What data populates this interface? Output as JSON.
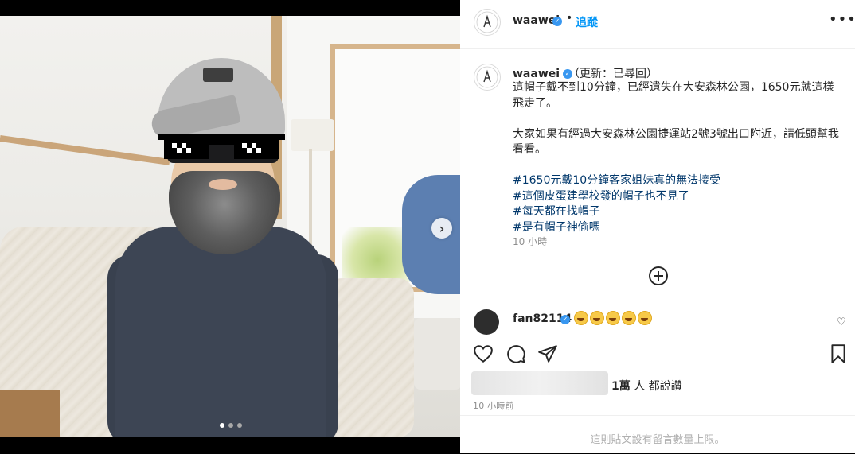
{
  "post": {
    "username": "waawei",
    "follow_label": "追蹤",
    "separator": "•",
    "more_label": "•••",
    "photo_dots": 3,
    "photo_dot_active": 1
  },
  "caption": {
    "username": "waawei",
    "note": "（更新：已尋回）",
    "line1": "這帽子戴不到10分鐘，已經遺失在大安森林公園，1650元就這樣飛走了。",
    "line2": "大家如果有經過大安森林公園捷運站2號3號出口附近，請低頭幫我看看。",
    "hashtags": [
      "#1650元戴10分鐘客家姐妹真的無法接受",
      "#這個皮蛋建學校發的帽子也不見了",
      "#每天都在找帽子",
      "#是有帽子神偷嗎"
    ],
    "time": "10 小時"
  },
  "comment": {
    "username": "fan82114",
    "emoji_count": 5
  },
  "actions": {
    "likes_count": "1萬",
    "likes_suffix": " 人 都說讚",
    "post_time": "10 小時前",
    "limit_notice": "這則貼文設有留言數量上限。"
  },
  "colors": {
    "link": "#0095f6",
    "hashtag": "#00376b",
    "verified": "#3897f0"
  }
}
